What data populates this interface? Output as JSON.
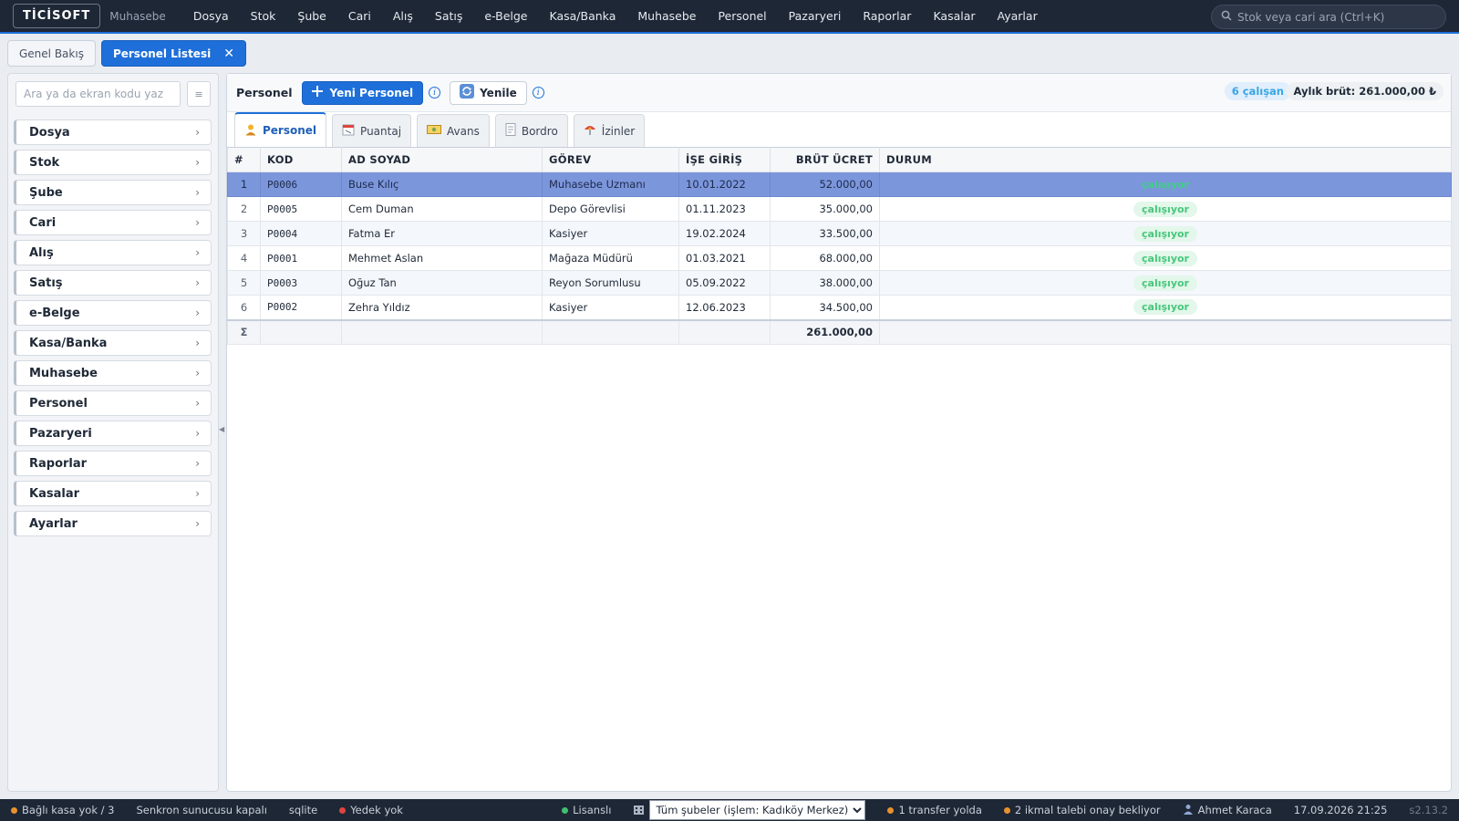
{
  "menubar": {
    "logo": "TİCİSOFT",
    "subtitle": "Muhasebe",
    "items": [
      "Dosya",
      "Stok",
      "Şube",
      "Cari",
      "Alış",
      "Satış",
      "e-Belge",
      "Kasa/Banka",
      "Muhasebe",
      "Personel",
      "Pazaryeri",
      "Raporlar",
      "Kasalar",
      "Ayarlar"
    ],
    "search_placeholder": "Stok veya cari ara (Ctrl+K)"
  },
  "tabs": {
    "overview": "Genel Bakış",
    "active": "Personel Listesi",
    "close": "✕"
  },
  "sidebar": {
    "search_placeholder": "Ara ya da ekran kodu yaz",
    "grid_button": "≡",
    "items": [
      "Dosya",
      "Stok",
      "Şube",
      "Cari",
      "Alış",
      "Satış",
      "e-Belge",
      "Kasa/Banka",
      "Muhasebe",
      "Personel",
      "Pazaryeri",
      "Raporlar",
      "Kasalar",
      "Ayarlar"
    ],
    "chevron": "›"
  },
  "toolbar": {
    "title": "Personel",
    "new_label": "Yeni Personel",
    "refresh_label": "Yenile",
    "info": "i",
    "count_badge": "6 çalışan",
    "total_badge": "Aylık brüt: 261.000,00 ₺"
  },
  "subtabs": [
    "Personel",
    "Puantaj",
    "Avans",
    "Bordro",
    "İzinler"
  ],
  "grid": {
    "headers": [
      "#",
      "KOD",
      "AD SOYAD",
      "GÖREV",
      "İŞE GİRİŞ",
      "BRÜT ÜCRET",
      "DURUM"
    ],
    "rows": [
      {
        "no": "1",
        "code": "P0006",
        "name": "Buse Kılıç",
        "role": "Muhasebe Uzmanı",
        "start": "10.01.2022",
        "salary": "52.000,00",
        "status": "çalışıyor"
      },
      {
        "no": "2",
        "code": "P0005",
        "name": "Cem Duman",
        "role": "Depo Görevlisi",
        "start": "01.11.2023",
        "salary": "35.000,00",
        "status": "çalışıyor"
      },
      {
        "no": "3",
        "code": "P0004",
        "name": "Fatma Er",
        "role": "Kasiyer",
        "start": "19.02.2024",
        "salary": "33.500,00",
        "status": "çalışıyor"
      },
      {
        "no": "4",
        "code": "P0001",
        "name": "Mehmet Aslan",
        "role": "Mağaza Müdürü",
        "start": "01.03.2021",
        "salary": "68.000,00",
        "status": "çalışıyor"
      },
      {
        "no": "5",
        "code": "P0003",
        "name": "Oğuz Tan",
        "role": "Reyon Sorumlusu",
        "start": "05.09.2022",
        "salary": "38.000,00",
        "status": "çalışıyor"
      },
      {
        "no": "6",
        "code": "P0002",
        "name": "Zehra Yıldız",
        "role": "Kasiyer",
        "start": "12.06.2023",
        "salary": "34.500,00",
        "status": "çalışıyor"
      }
    ],
    "footer": {
      "sigma": "Σ",
      "total": "261.000,00"
    }
  },
  "statusbar": {
    "cash": "Bağlı kasa yok / 3",
    "sync": "Senkron sunucusu kapalı",
    "db": "sqlite",
    "backup": "Yedek yok",
    "license": "Lisanslı",
    "branch_select": "Tüm şubeler (işlem: Kadıköy Merkez)",
    "transfer": "1 transfer yolda",
    "supply": "2 ikmal talebi onay bekliyor",
    "user": "Ahmet Karaca",
    "datetime": "17.09.2026 21:25",
    "version": "s2.13.2"
  },
  "colors": {
    "accent": "#1e6fd9",
    "menubar": "#1e2736",
    "selected_row": "#7c96dc",
    "status_ok": "#47c77b",
    "dot_orange": "#e8912d",
    "dot_red": "#e0443e",
    "dot_green": "#3fbf6f"
  }
}
